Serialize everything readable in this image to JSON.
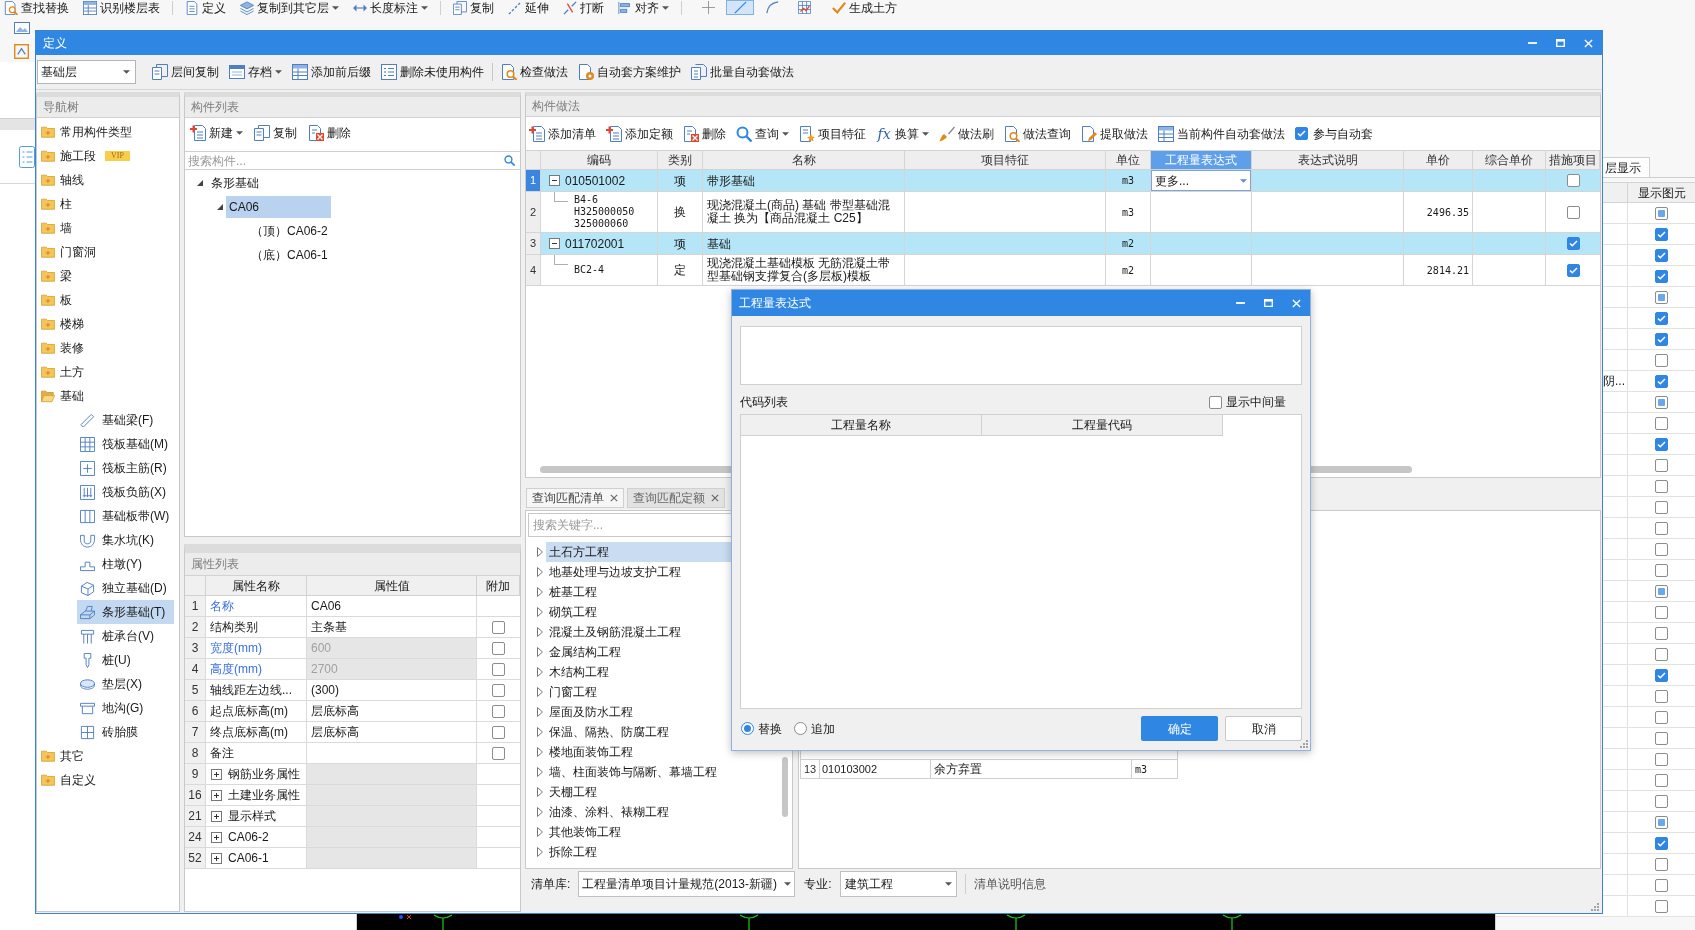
{
  "background_app": {
    "ribbon_groups": [
      [
        {
          "label": "查找替换",
          "dropdown": false
        },
        {
          "label": "识别楼层表",
          "dropdown": false
        }
      ],
      [
        {
          "label": "定义",
          "dropdown": false
        },
        {
          "label": "复制到其它层",
          "dropdown": true
        },
        {
          "label": "长度标注",
          "dropdown": true
        }
      ],
      [
        {
          "label": "复制",
          "dropdown": false
        },
        {
          "label": "延伸",
          "dropdown": false
        },
        {
          "label": "打断",
          "dropdown": false
        },
        {
          "label": "对齐",
          "dropdown": true
        }
      ]
    ],
    "canvas_tools": [
      {
        "selected": false
      },
      {
        "selected": true
      },
      {
        "selected": false
      },
      {
        "selected": false
      }
    ],
    "earthwork_button": {
      "label": "生成土方"
    },
    "layer_panel": {
      "tab": "层显示",
      "column": "显示图元",
      "rows": [
        {
          "checked": false,
          "partial": true
        },
        {
          "checked": true
        },
        {
          "checked": true
        },
        {
          "checked": true
        },
        {
          "checked": false,
          "partial": true
        },
        {
          "checked": true
        },
        {
          "checked": true
        },
        {
          "checked": false,
          "partial": false
        },
        {
          "text": "阴...",
          "checked": true
        },
        {
          "checked": false,
          "partial": true
        },
        {
          "checked": false,
          "partial": false
        },
        {
          "checked": true
        },
        {
          "checked": false,
          "partial": false
        },
        {
          "checked": false,
          "partial": false
        },
        {
          "checked": false,
          "partial": false
        },
        {
          "checked": false,
          "partial": false
        },
        {
          "checked": false,
          "partial": false
        },
        {
          "checked": false,
          "partial": false
        },
        {
          "checked": false,
          "partial": true
        },
        {
          "checked": false,
          "partial": false
        },
        {
          "checked": false,
          "partial": false
        },
        {
          "checked": false,
          "partial": false
        },
        {
          "checked": true
        },
        {
          "checked": false,
          "partial": false
        },
        {
          "checked": false,
          "partial": false
        },
        {
          "checked": false,
          "partial": false
        },
        {
          "checked": false,
          "partial": false
        },
        {
          "checked": false,
          "partial": false
        },
        {
          "checked": false,
          "partial": false
        },
        {
          "checked": false,
          "partial": true
        },
        {
          "checked": true
        },
        {
          "checked": false,
          "partial": false
        },
        {
          "checked": false,
          "partial": false
        },
        {
          "checked": false,
          "partial": false
        }
      ]
    }
  },
  "define_window": {
    "title": "定义",
    "toolbar": {
      "layer": "基础层",
      "groups": [
        [
          {
            "label": "层间复制",
            "dropdown": false
          },
          {
            "label": "存档",
            "dropdown": true
          },
          {
            "label": "添加前后缀",
            "dropdown": false
          },
          {
            "label": "删除未使用构件",
            "dropdown": false
          }
        ],
        [
          {
            "label": "检查做法",
            "dropdown": false
          },
          {
            "label": "自动套方案维护",
            "dropdown": false
          },
          {
            "label": "批量自动套做法",
            "dropdown": false
          }
        ]
      ]
    },
    "nav_tree": {
      "title": "导航树",
      "items": [
        {
          "label": "常用构件类型",
          "expanded": false,
          "selected": false
        },
        {
          "label": "施工段",
          "badge": "VIP",
          "expanded": false,
          "selected": false
        },
        {
          "label": "轴线",
          "expanded": false,
          "selected": false
        },
        {
          "label": "柱",
          "expanded": false,
          "selected": false
        },
        {
          "label": "墙",
          "expanded": false,
          "selected": false
        },
        {
          "label": "门窗洞",
          "expanded": false,
          "selected": false
        },
        {
          "label": "梁",
          "expanded": false,
          "selected": false
        },
        {
          "label": "板",
          "expanded": false,
          "selected": false
        },
        {
          "label": "楼梯",
          "expanded": false,
          "selected": false
        },
        {
          "label": "装修",
          "expanded": false,
          "selected": false
        },
        {
          "label": "土方",
          "expanded": false,
          "selected": false
        },
        {
          "label": "基础",
          "expanded": true,
          "selected": false,
          "children": [
            {
              "label": "基础梁(F)",
              "selected": false
            },
            {
              "label": "筏板基础(M)",
              "selected": false
            },
            {
              "label": "筏板主筋(R)",
              "selected": false
            },
            {
              "label": "筏板负筋(X)",
              "selected": false
            },
            {
              "label": "基础板带(W)",
              "selected": false
            },
            {
              "label": "集水坑(K)",
              "selected": false
            },
            {
              "label": "柱墩(Y)",
              "selected": false
            },
            {
              "label": "独立基础(D)",
              "selected": false
            },
            {
              "label": "条形基础(T)",
              "selected": true
            },
            {
              "label": "桩承台(V)",
              "selected": false
            },
            {
              "label": "桩(U)",
              "selected": false
            },
            {
              "label": "垫层(X)",
              "selected": false
            },
            {
              "label": "地沟(G)",
              "selected": false
            },
            {
              "label": "砖胎膜",
              "selected": false
            }
          ]
        },
        {
          "label": "其它",
          "expanded": false,
          "selected": false
        },
        {
          "label": "自定义",
          "expanded": false,
          "selected": false
        }
      ]
    },
    "component_list": {
      "title": "构件列表",
      "toolbar": [
        {
          "label": "新建",
          "dropdown": true
        },
        {
          "label": "复制",
          "dropdown": false
        },
        {
          "label": "删除",
          "dropdown": false
        }
      ],
      "search": {
        "placeholder": "搜索构件..."
      },
      "tree": [
        {
          "label": "条形基础",
          "expanded": true,
          "selected": false,
          "children": [
            {
              "label": "CA06",
              "expanded": true,
              "selected": true,
              "children": [
                {
                  "label": "（顶）CA06-2",
                  "selected": false
                },
                {
                  "label": "（底）CA06-1",
                  "selected": false
                }
              ]
            }
          ]
        }
      ]
    },
    "properties": {
      "title": "属性列表",
      "columns": [
        "属性名称",
        "属性值",
        "附加"
      ],
      "rows": [
        {
          "num": "1",
          "kind": "fixed",
          "name": "名称",
          "public": true,
          "value": "CA06",
          "disabled": false
        },
        {
          "num": "2",
          "kind": "attr",
          "name": "结构类别",
          "public": false,
          "value": "主条基",
          "disabled": false,
          "checked": false
        },
        {
          "num": "3",
          "kind": "attr",
          "name": "宽度(mm)",
          "public": true,
          "value": "600",
          "disabled": true,
          "checked": false
        },
        {
          "num": "4",
          "kind": "attr",
          "name": "高度(mm)",
          "public": true,
          "value": "2700",
          "disabled": true,
          "checked": false
        },
        {
          "num": "5",
          "kind": "attr",
          "name": "轴线距左边线...",
          "public": false,
          "value": "(300)",
          "disabled": false,
          "checked": false
        },
        {
          "num": "6",
          "kind": "attr",
          "name": "起点底标高(m)",
          "public": false,
          "value": "层底标高",
          "disabled": false,
          "checked": false
        },
        {
          "num": "7",
          "kind": "attr",
          "name": "终点底标高(m)",
          "public": false,
          "value": "层底标高",
          "disabled": false,
          "checked": false
        },
        {
          "num": "8",
          "kind": "attr",
          "name": "备注",
          "public": false,
          "checked": false
        },
        {
          "num": "9",
          "kind": "group",
          "name": "钢筋业务属性",
          "expanded": false
        },
        {
          "num": "16",
          "kind": "group",
          "name": "土建业务属性",
          "expanded": false
        },
        {
          "num": "21",
          "kind": "group",
          "name": "显示样式",
          "expanded": false
        },
        {
          "num": "24",
          "kind": "group",
          "name": "CA06-2",
          "expanded": false
        },
        {
          "num": "52",
          "kind": "group",
          "name": "CA06-1",
          "expanded": false
        }
      ]
    },
    "methods": {
      "title": "构件做法",
      "toolbar": [
        {
          "label": "添加清单",
          "dropdown": false
        },
        {
          "label": "添加定额",
          "dropdown": false
        },
        {
          "label": "删除",
          "dropdown": false
        },
        {
          "label": "查询",
          "dropdown": true
        },
        {
          "label": "项目特征",
          "dropdown": false
        },
        {
          "label": "换算",
          "glyph": "fx",
          "dropdown": true
        },
        {
          "label": "做法刷",
          "dropdown": false
        },
        {
          "label": "做法查询",
          "dropdown": false
        },
        {
          "label": "提取做法",
          "dropdown": false
        },
        {
          "label": "当前构件自动套做法",
          "dropdown": false
        }
      ],
      "auto_apply": {
        "label": "参与自动套",
        "checked": true
      },
      "columns": [
        {
          "label": "编码",
          "selected": false
        },
        {
          "label": "类别",
          "selected": false
        },
        {
          "label": "名称",
          "selected": false
        },
        {
          "label": "项目特征",
          "selected": false
        },
        {
          "label": "单位",
          "selected": false
        },
        {
          "label": "工程量表达式",
          "selected": true
        },
        {
          "label": "表达式说明",
          "selected": false
        },
        {
          "label": "单价",
          "selected": false
        },
        {
          "label": "综合单价",
          "selected": false
        },
        {
          "label": "措施项目",
          "selected": false
        }
      ],
      "rows": [
        {
          "num": "1",
          "kind": "item",
          "selected": true,
          "expanded": true,
          "code": "010501002",
          "type": "项",
          "name": "带形基础",
          "unit": "m3",
          "expression": "更多...",
          "measure": false
        },
        {
          "num": "2",
          "kind": "sub",
          "selected": false,
          "code": "B4-6 H325000050 325000060",
          "type": "换",
          "name": "现浇混凝土(商品) 基础 带型基础混凝土 换为【商品混凝土 C25】",
          "unit": "m3",
          "price": "2496.35",
          "measure": false
        },
        {
          "num": "3",
          "kind": "item",
          "selected": false,
          "expanded": true,
          "code": "011702001",
          "type": "项",
          "name": "基础",
          "unit": "m2",
          "measure": true
        },
        {
          "num": "4",
          "kind": "sub",
          "selected": false,
          "code": "BC2-4",
          "type": "定",
          "name": "现浇混凝土基础模板 无筋混凝土带型基础钢支撑复合(多层板)模板",
          "unit": "m2",
          "price": "2814.21",
          "measure": true
        }
      ]
    },
    "query": {
      "tabs": [
        {
          "label": "查询匹配清单",
          "selected": true
        },
        {
          "label": "查询匹配定额",
          "selected": false
        }
      ],
      "search": {
        "placeholder": "搜索关键字..."
      },
      "categories": [
        {
          "label": "土石方工程",
          "expanded": false,
          "selected": true
        },
        {
          "label": "地基处理与边坡支护工程",
          "expanded": false,
          "selected": false
        },
        {
          "label": "桩基工程",
          "expanded": false,
          "selected": false
        },
        {
          "label": "砌筑工程",
          "expanded": false,
          "selected": false
        },
        {
          "label": "混凝土及钢筋混凝土工程",
          "expanded": false,
          "selected": false
        },
        {
          "label": "金属结构工程",
          "expanded": false,
          "selected": false
        },
        {
          "label": "木结构工程",
          "expanded": false,
          "selected": false
        },
        {
          "label": "门窗工程",
          "expanded": false,
          "selected": false
        },
        {
          "label": "屋面及防水工程",
          "expanded": false,
          "selected": false
        },
        {
          "label": "保温、隔热、防腐工程",
          "expanded": false,
          "selected": false
        },
        {
          "label": "楼地面装饰工程",
          "expanded": false,
          "selected": false
        },
        {
          "label": "墙、柱面装饰与隔断、幕墙工程",
          "expanded": false,
          "selected": false
        },
        {
          "label": "天棚工程",
          "expanded": false,
          "selected": false
        },
        {
          "label": "油漆、涂料、裱糊工程",
          "expanded": false,
          "selected": false
        },
        {
          "label": "其他装饰工程",
          "expanded": false,
          "selected": false
        },
        {
          "label": "拆除工程",
          "expanded": false,
          "selected": false
        }
      ],
      "match_rows": [
        {
          "num": "13",
          "code": "010103002",
          "name": "余方弃置",
          "unit": "m3"
        }
      ],
      "library_label": "清单库:",
      "library": "工程量清单项目计量规范(2013-新疆)",
      "specialty_label": "专业:",
      "specialty": "建筑工程",
      "info": "清单说明信息"
    }
  },
  "dialog": {
    "title": "工程量表达式",
    "code_list_label": "代码列表",
    "show_intermediate": {
      "label": "显示中间量",
      "checked": false
    },
    "columns": [
      "工程量名称",
      "工程量代码"
    ],
    "modes": [
      {
        "label": "替换",
        "selected": true
      },
      {
        "label": "追加",
        "selected": false
      }
    ],
    "buttons": [
      {
        "label": "确定",
        "kind": "primary"
      },
      {
        "label": "取消",
        "kind": "secondary"
      }
    ]
  }
}
